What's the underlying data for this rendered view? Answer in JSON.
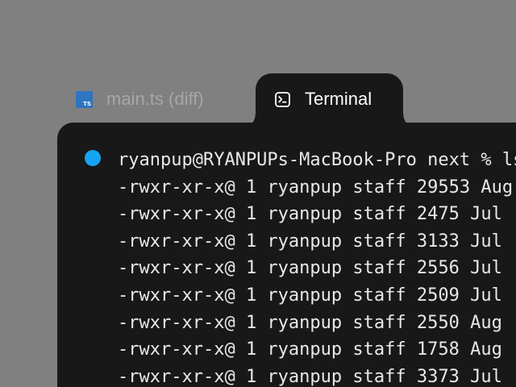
{
  "tabs": [
    {
      "label": "main.ts (diff)",
      "icon": "typescript-file-icon",
      "icon_text": "TS",
      "active": false
    },
    {
      "label": "Terminal",
      "icon": "terminal-icon",
      "active": true
    }
  ],
  "terminal": {
    "status_color": "#16a4f2",
    "lines": [
      "ryanpup@RYANPUPs-MacBook-Pro next % ls -l",
      "-rwxr-xr-x@ 1 ryanpup staff 29553 Aug",
      "-rwxr-xr-x@ 1 ryanpup staff 2475 Jul",
      "-rwxr-xr-x@ 1 ryanpup staff 3133 Jul",
      "-rwxr-xr-x@ 1 ryanpup staff 2556 Jul",
      "-rwxr-xr-x@ 1 ryanpup staff 2509 Jul",
      "-rwxr-xr-x@ 1 ryanpup staff 2550 Aug",
      "-rwxr-xr-x@ 1 ryanpup staff 1758 Aug",
      "-rwxr-xr-x@ 1 ryanpup staff 3373 Jul"
    ]
  }
}
